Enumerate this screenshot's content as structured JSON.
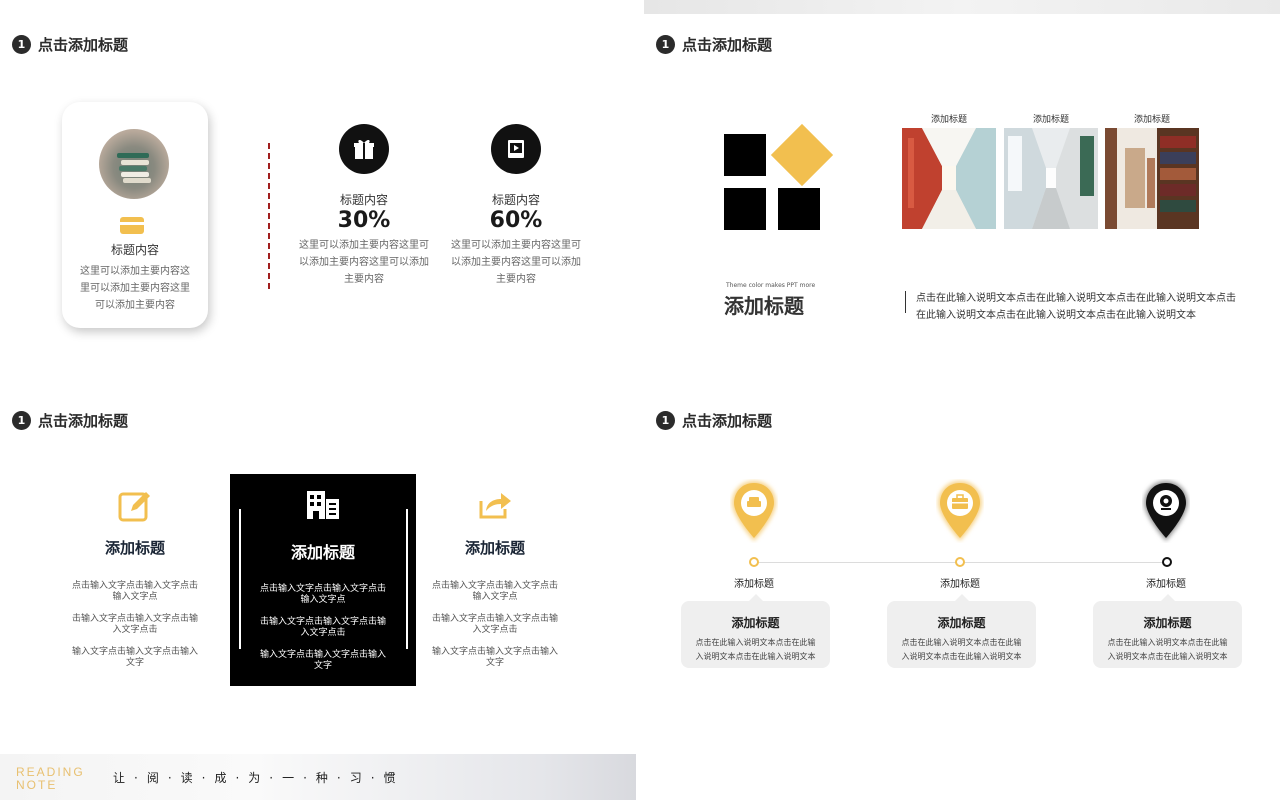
{
  "slide1": {
    "heading": {
      "num": "1",
      "text": "点击添加标题"
    },
    "card": {
      "title": "标题内容",
      "body": "这里可以添加主要内容这里可以添加主要内容这里可以添加主要内容"
    },
    "stats": [
      {
        "label": "标题内容",
        "value": "30%",
        "desc": "这里可以添加主要内容这里可以添加主要内容这里可以添加主要内容",
        "icon": "gift-icon"
      },
      {
        "label": "标题内容",
        "value": "60%",
        "desc": "这里可以添加主要内容这里可以添加主要内容这里可以添加主要内容",
        "icon": "book-icon"
      }
    ]
  },
  "slide2": {
    "heading": {
      "num": "1",
      "text": "点击添加标题"
    },
    "photos": [
      {
        "label": "添加标题"
      },
      {
        "label": "添加标题"
      },
      {
        "label": "添加标题"
      }
    ],
    "small": "Theme color makes PPT more",
    "title": "添加标题",
    "body": "点击在此输入说明文本点击在此输入说明文本点击在此输入说明文本点击在此输入说明文本点击在此输入说明文本点击在此输入说明文本"
  },
  "slide3": {
    "heading": {
      "num": "1",
      "text": "点击添加标题"
    },
    "columns": [
      {
        "title": "添加标题",
        "p1": "点击输入文字点击输入文字点击输入文字点",
        "p2": "击输入文字点击输入文字点击输入文字点击",
        "p3": "输入文字点击输入文字点击输入文字",
        "icon": "edit-icon"
      },
      {
        "title": "添加标题",
        "p1": "点击输入文字点击输入文字点击输入文字点",
        "p2": "击输入文字点击输入文字点击输入文字点击",
        "p3": "输入文字点击输入文字点击输入文字",
        "icon": "building-icon"
      },
      {
        "title": "添加标题",
        "p1": "点击输入文字点击输入文字点击输入文字点",
        "p2": "击输入文字点击输入文字点击输入文字点击",
        "p3": "输入文字点击输入文字点击输入文字",
        "icon": "share-icon"
      }
    ],
    "reading_line1": "READING",
    "reading_line2": "NOTE",
    "motto": "让·阅·读·成·为·一·种·习·惯"
  },
  "slide4": {
    "heading": {
      "num": "1",
      "text": "点击添加标题"
    },
    "steps": [
      {
        "label": "添加标题",
        "box_title": "添加标题",
        "box_body": "点击在此输入说明文本点击在此输入说明文本点击在此输入说明文本",
        "icon": "sofa-icon"
      },
      {
        "label": "添加标题",
        "box_title": "添加标题",
        "box_body": "点击在此输入说明文本点击在此输入说明文本点击在此输入说明文本",
        "icon": "briefcase-icon"
      },
      {
        "label": "添加标题",
        "box_title": "添加标题",
        "box_body": "点击在此输入说明文本点击在此输入说明文本点击在此输入说明文本",
        "icon": "webcam-icon"
      }
    ]
  },
  "colors": {
    "accent": "#f2bf4f",
    "dark": "#111111",
    "dash": "#a01e1e"
  }
}
